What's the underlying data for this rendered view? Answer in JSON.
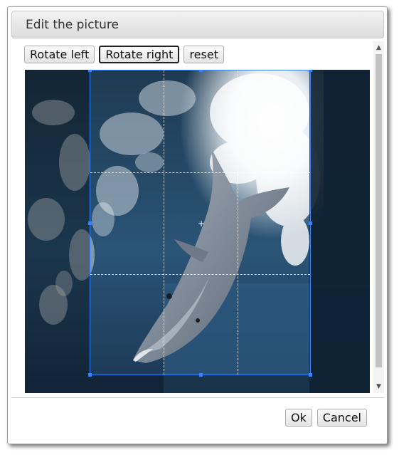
{
  "dialog": {
    "title": "Edit the picture"
  },
  "toolbar": {
    "rotate_left_label": "Rotate left",
    "rotate_right_label": "Rotate right",
    "reset_label": "reset"
  },
  "footer": {
    "ok_label": "Ok",
    "cancel_label": "Cancel"
  },
  "scrollbar": {
    "up_arrow": "▲",
    "down_arrow": "▼"
  },
  "image": {
    "subject": "dolphin leaping through water"
  },
  "colors": {
    "accent": "#3b82f6",
    "titlebar_top": "#f2f2f2",
    "titlebar_bottom": "#dcdcdc"
  }
}
